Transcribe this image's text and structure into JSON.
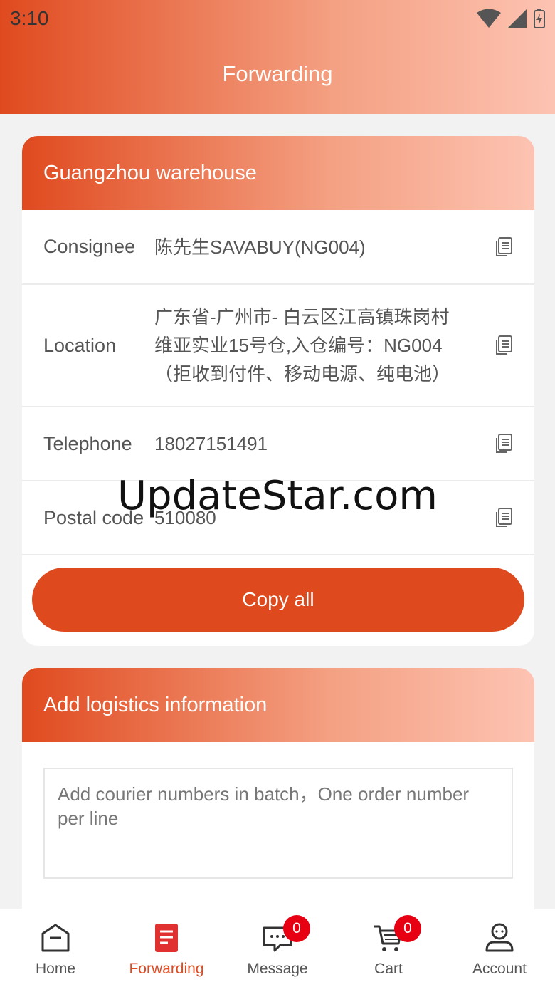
{
  "status_bar": {
    "time": "3:10"
  },
  "header": {
    "title": "Forwarding"
  },
  "warehouse": {
    "title": "Guangzhou warehouse",
    "rows": [
      {
        "label": "Consignee",
        "value": "陈先生SAVABUY(NG004)"
      },
      {
        "label": "Location",
        "value": "广东省-广州市- 白云区江高镇珠岗村维亚实业15号仓,入仓编号：NG004（拒收到付件、移动电源、纯电池）"
      },
      {
        "label": "Telephone",
        "value": "18027151491"
      },
      {
        "label": "Postal code",
        "value": "510080"
      }
    ],
    "copy_all_label": "Copy all"
  },
  "logistics": {
    "title": "Add logistics information",
    "placeholder": "Add  courier numbers in batch，One order number per line"
  },
  "watermark": "UpdateStar.com",
  "tabbar": {
    "tabs": [
      {
        "label": "Home",
        "icon": "home-icon"
      },
      {
        "label": "Forwarding",
        "icon": "forwarding-icon",
        "active": true
      },
      {
        "label": "Message",
        "icon": "message-icon",
        "badge": "0"
      },
      {
        "label": "Cart",
        "icon": "cart-icon",
        "badge": "0"
      },
      {
        "label": "Account",
        "icon": "account-icon"
      }
    ]
  },
  "colors": {
    "accent": "#e04a1f",
    "badge": "#e60012"
  }
}
